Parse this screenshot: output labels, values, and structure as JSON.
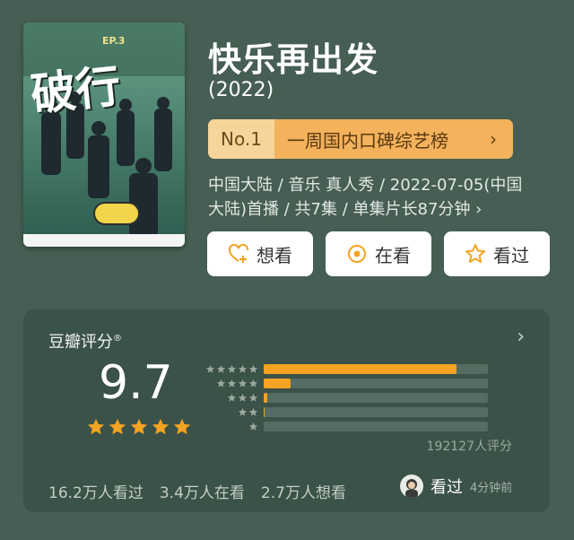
{
  "poster": {
    "title_art": "破行",
    "episode_tag": "EP.3"
  },
  "title": "快乐再出发",
  "year": "(2022)",
  "rank": {
    "number": "No.1",
    "name": "一周国内口碑综艺榜",
    "chevron": "›"
  },
  "meta": {
    "line1": "中国大陆 / 音乐 真人秀 / 2022-07-05(中国",
    "line2": "大陆)首播 / 共7集 / 单集片长87分钟 ›"
  },
  "actions": {
    "want": {
      "label": "想看",
      "icon": "heart-plus-icon"
    },
    "doing": {
      "label": "在看",
      "icon": "target-icon"
    },
    "done": {
      "label": "看过",
      "icon": "star-outline-icon"
    }
  },
  "rating": {
    "title": "豆瓣评分",
    "registered": "®",
    "score": "9.7",
    "stars": 5,
    "distribution": [
      {
        "stars": 5,
        "fraction": 0.86
      },
      {
        "stars": 4,
        "fraction": 0.12
      },
      {
        "stars": 3,
        "fraction": 0.015
      },
      {
        "stars": 2,
        "fraction": 0.004
      },
      {
        "stars": 1,
        "fraction": 0.0
      }
    ],
    "count": "192127人评分"
  },
  "stats": {
    "watched": "16.2万人看过",
    "watching": "3.4万人在看",
    "want": "2.7万人想看"
  },
  "recent": {
    "action": "看过",
    "time": "4分钟前"
  },
  "colors": {
    "background": "#465e53",
    "card": "#3b5248",
    "accent_orange": "#f4a322",
    "rank_light": "#f7d59a",
    "rank_dark": "#f4b25d"
  }
}
